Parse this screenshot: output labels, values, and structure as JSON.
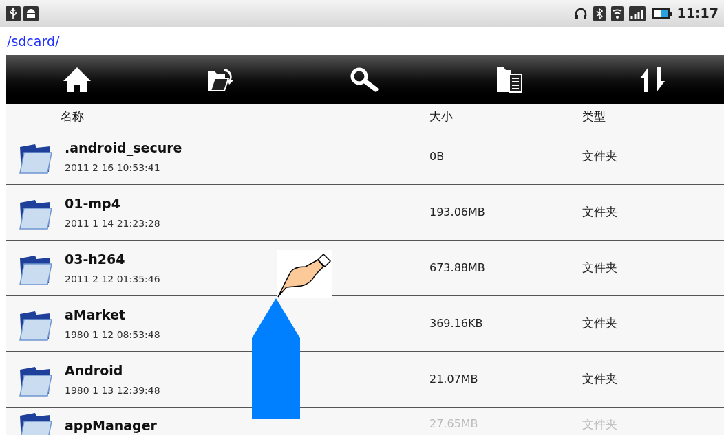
{
  "status_bar": {
    "time": "11:17"
  },
  "path": "/sdcard/",
  "toolbar": [
    {
      "kind": "home"
    },
    {
      "kind": "open"
    },
    {
      "kind": "search"
    },
    {
      "kind": "list"
    },
    {
      "kind": "sort"
    }
  ],
  "columns": [
    "名称",
    "大小",
    "类型"
  ],
  "rows": [
    {
      "name": ".android_secure",
      "date": "2011 2 16 10:53:41",
      "size": "0B",
      "type": "文件夹"
    },
    {
      "name": "01-mp4",
      "date": "2011 1 14 21:23:28",
      "size": "193.06MB",
      "type": "文件夹"
    },
    {
      "name": "03-h264",
      "date": "2011 2 12 01:35:46",
      "size": "673.88MB",
      "type": "文件夹"
    },
    {
      "name": "aMarket",
      "date": "1980 1 12 08:53:48",
      "size": "369.16KB",
      "type": "文件夹"
    },
    {
      "name": "Android",
      "date": "1980 1 13 12:39:48",
      "size": "21.07MB",
      "type": "文件夹"
    },
    {
      "name": "appManager",
      "size": "27.65MB",
      "type": "文件夹"
    }
  ]
}
